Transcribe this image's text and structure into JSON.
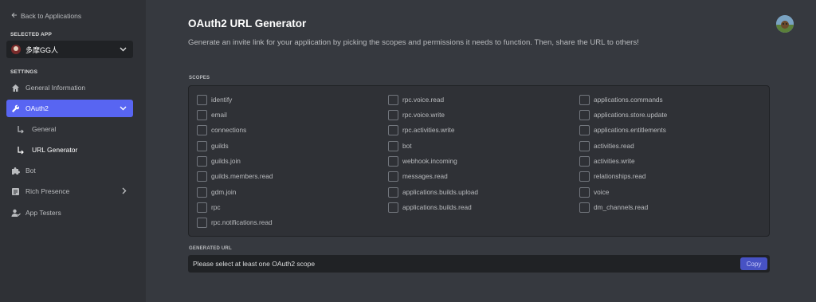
{
  "sidebar": {
    "back_label": "Back to Applications",
    "selected_app_heading": "SELECTED APP",
    "app_name": "多摩GG人",
    "settings_heading": "SETTINGS",
    "items": {
      "general_information": "General Information",
      "oauth2": "OAuth2",
      "oauth2_general": "General",
      "url_generator": "URL Generator",
      "bot": "Bot",
      "rich_presence": "Rich Presence",
      "app_testers": "App Testers"
    }
  },
  "main": {
    "title": "OAuth2 URL Generator",
    "description": "Generate an invite link for your application by picking the scopes and permissions it needs to function. Then, share the URL to others!",
    "scopes_label": "SCOPES",
    "scopes": {
      "col1": [
        "identify",
        "email",
        "connections",
        "guilds",
        "guilds.join",
        "guilds.members.read",
        "gdm.join",
        "rpc",
        "rpc.notifications.read"
      ],
      "col2": [
        "rpc.voice.read",
        "rpc.voice.write",
        "rpc.activities.write",
        "bot",
        "webhook.incoming",
        "messages.read",
        "applications.builds.upload",
        "applications.builds.read"
      ],
      "col3": [
        "applications.commands",
        "applications.store.update",
        "applications.entitlements",
        "activities.read",
        "activities.write",
        "relationships.read",
        "voice",
        "dm_channels.read"
      ]
    },
    "generated_url_label": "GENERATED URL",
    "generated_url_value": "Please select at least one OAuth2 scope",
    "copy_label": "Copy"
  },
  "colors": {
    "accent": "#5865f2",
    "sidebar_bg": "#2f3136",
    "main_bg": "#36393f",
    "copy_button": "#4752c4"
  }
}
